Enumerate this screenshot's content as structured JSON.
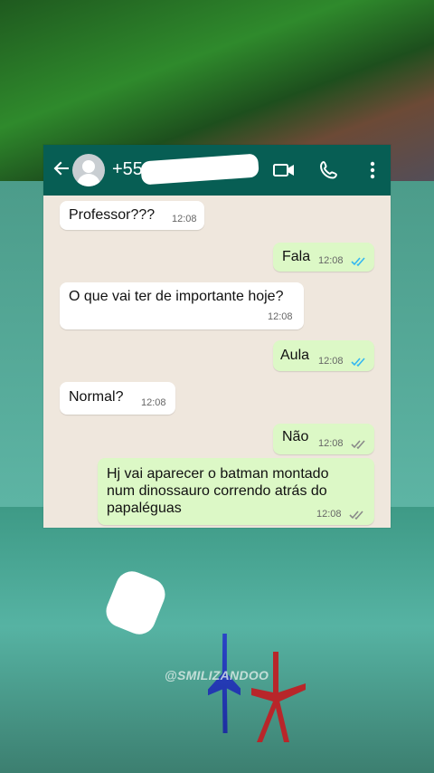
{
  "background": {
    "watermark": "@SMILIZANDOO"
  },
  "topbar": {
    "contact_prefix": "+55",
    "icons": [
      "back-arrow-icon",
      "avatar",
      "video-call-icon",
      "phone-icon",
      "more-vert-icon"
    ],
    "colors": {
      "bar": "#075e54"
    }
  },
  "messages": [
    {
      "dir": "in",
      "text": "Professor???",
      "time": "12:08"
    },
    {
      "dir": "out",
      "text": "Fala",
      "time": "12:08",
      "status": "read"
    },
    {
      "dir": "in",
      "text": "O que vai ter de importante hoje?",
      "time": "12:08"
    },
    {
      "dir": "out",
      "text": "Aula",
      "time": "12:08",
      "status": "read"
    },
    {
      "dir": "in",
      "text": "Normal?",
      "time": "12:08"
    },
    {
      "dir": "out",
      "text": "Não",
      "time": "12:08",
      "status": "delivered"
    },
    {
      "dir": "out",
      "text": "Hj vai aparecer o batman montado num dinossauro correndo atrás do papaléguas",
      "time": "12:08",
      "status": "delivered"
    }
  ]
}
